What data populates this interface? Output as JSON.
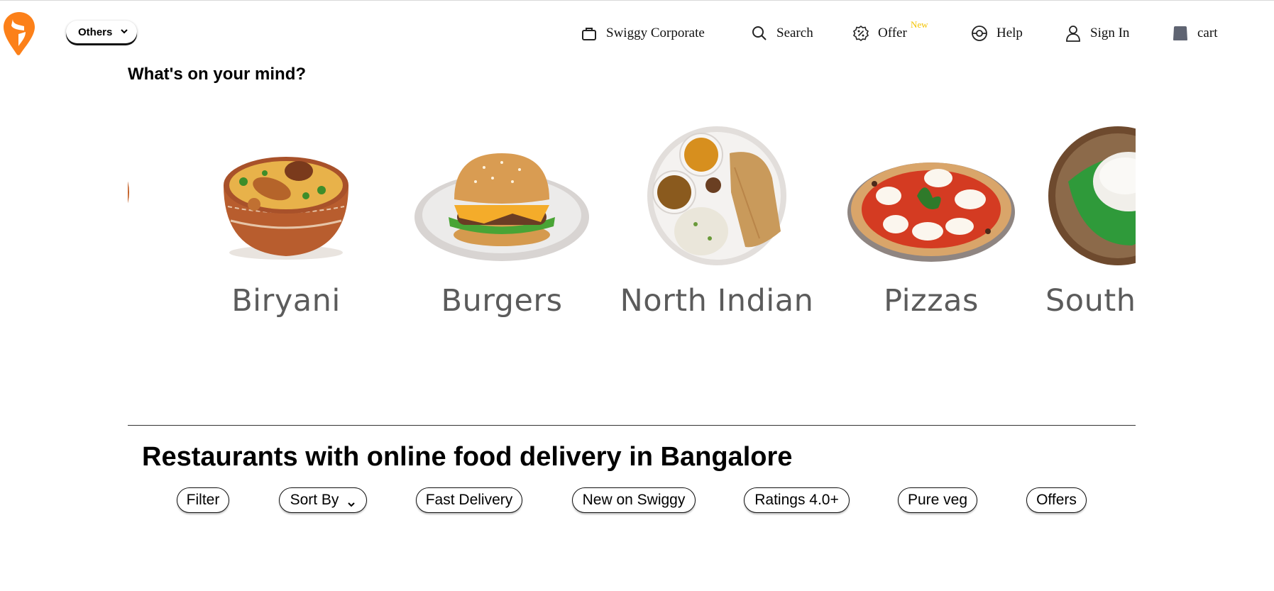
{
  "location": {
    "selected": "Others"
  },
  "nav": {
    "corporate": "Swiggy Corporate",
    "search": "Search",
    "offer": "Offer",
    "offer_badge": "New",
    "help": "Help",
    "signin": "Sign In",
    "cart": "cart"
  },
  "mind": {
    "title": "What's on your mind?",
    "items": [
      {
        "label": "Biryani"
      },
      {
        "label": "Burgers"
      },
      {
        "label": "North Indian"
      },
      {
        "label": "Pizzas"
      },
      {
        "label": "South"
      }
    ]
  },
  "restaurants": {
    "heading": "Restaurants with online food delivery in Bangalore",
    "filters": [
      "Filter",
      "Sort By",
      "Fast Delivery",
      "New on Swiggy",
      "Ratings 4.0+",
      "Pure veg",
      "Offers"
    ]
  },
  "colors": {
    "brand": "#fc8019",
    "badge": "#f3c300",
    "label": "#5b5b5b"
  },
  "icons": [
    "swiggy-logo-icon",
    "chevron-down-icon",
    "briefcase-icon",
    "search-icon",
    "offer-percent-icon",
    "help-icon",
    "user-icon",
    "cart-bag-icon"
  ]
}
